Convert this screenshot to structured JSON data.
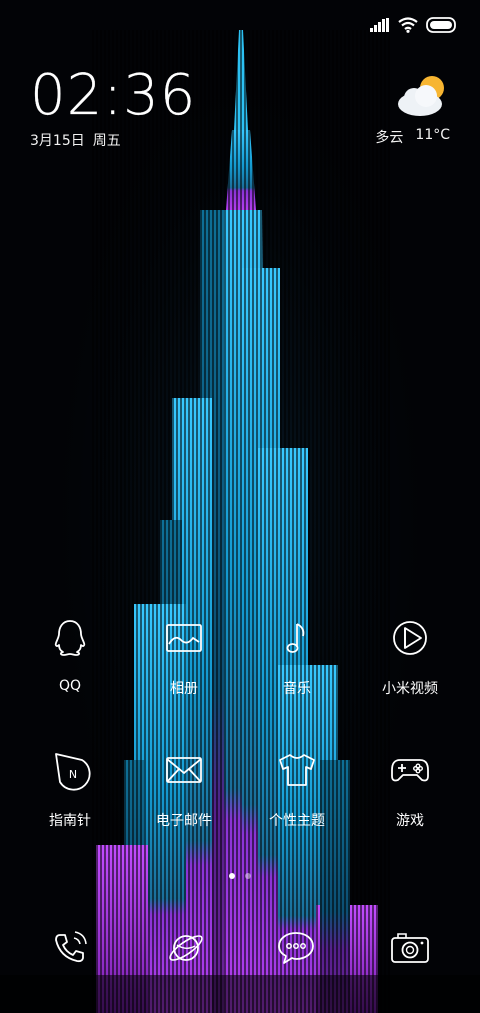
{
  "status": {
    "signal_icon": "cellular-signal-icon",
    "wifi_icon": "wifi-icon",
    "battery_icon": "battery-icon"
  },
  "clock": {
    "time": "02:36",
    "date": "3月15日",
    "weekday": "周五"
  },
  "weather": {
    "icon": "partly-cloudy-icon",
    "condition": "多云",
    "temperature": "11°C"
  },
  "apps": [
    {
      "label": "QQ",
      "icon": "qq-penguin-icon"
    },
    {
      "label": "相册",
      "icon": "gallery-icon"
    },
    {
      "label": "音乐",
      "icon": "music-note-icon"
    },
    {
      "label": "小米视频",
      "icon": "video-play-icon"
    },
    {
      "label": "指南针",
      "icon": "compass-icon"
    },
    {
      "label": "电子邮件",
      "icon": "envelope-icon"
    },
    {
      "label": "个性主题",
      "icon": "tshirt-icon"
    },
    {
      "label": "游戏",
      "icon": "gamepad-icon"
    }
  ],
  "pages": {
    "count": 2,
    "active": 1
  },
  "dock": [
    {
      "icon": "phone-icon"
    },
    {
      "icon": "browser-planet-icon"
    },
    {
      "icon": "message-bubble-icon"
    },
    {
      "icon": "camera-icon"
    }
  ],
  "colors": {
    "background": "#020306",
    "tower_cyan": "#1fb8e6",
    "tower_purple": "#b23df0",
    "sun": "#f7b531"
  }
}
